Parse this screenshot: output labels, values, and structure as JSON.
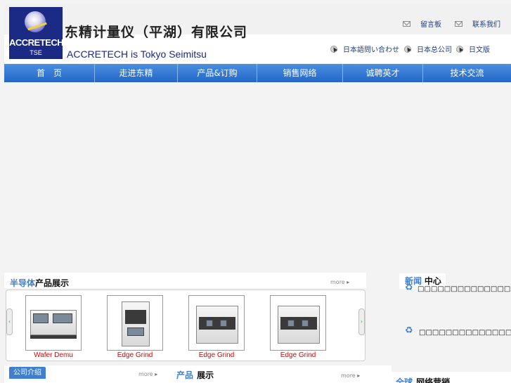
{
  "header": {
    "logo": {
      "name": "ACCRETECH",
      "sub": "TSE"
    },
    "company_title": "东精计量仪（平湖）有限公司",
    "company_en": "ACCRETECH is Tokyo Seimitsu",
    "top_links": [
      {
        "label": "留言板",
        "icon": "mail-icon"
      },
      {
        "label": "联系我们",
        "icon": "mail-icon"
      }
    ],
    "sub_links": [
      {
        "label": "日本語問い合わせ",
        "icon": "cursor-icon"
      },
      {
        "label": "日本总公司",
        "icon": "cursor-icon"
      },
      {
        "label": "日文版",
        "icon": "cursor-icon"
      }
    ]
  },
  "nav": {
    "items": [
      {
        "label": "首　页"
      },
      {
        "label": "走进东精"
      },
      {
        "label": "产品&订购"
      },
      {
        "label": "销售网络"
      },
      {
        "label": "诚聘英才"
      },
      {
        "label": "技术交流"
      }
    ]
  },
  "products_section": {
    "title_highlight": "半导体",
    "title_rest": "产品展示",
    "more": "more",
    "items": [
      {
        "name": "Wafer Demu"
      },
      {
        "name": "Edge Grind"
      },
      {
        "name": "Edge Grind"
      },
      {
        "name": "Edge Grind"
      }
    ]
  },
  "news_section": {
    "title_highlight": "新闻",
    "title_rest": "中心",
    "items": [
      {
        "text": "□□□□□□□□□□□□□□□□□□□□□□□□□□□□□□"
      },
      {
        "text": "□□□□□□□□□□□□□□□□□□□□□□□□□□□□□□"
      }
    ]
  },
  "bottom": {
    "company_tab": "公司介绍",
    "company_more": "more",
    "products_title_highlight": "产品",
    "products_title_rest": "展示",
    "products_more": "more",
    "network_title_highlight": "全球",
    "network_title_rest": "网络营销"
  },
  "colors": {
    "nav": "#2466c8",
    "accent": "#3f7fcf",
    "product_name": "#dd0000",
    "logo_bg": "#1a2a85"
  }
}
